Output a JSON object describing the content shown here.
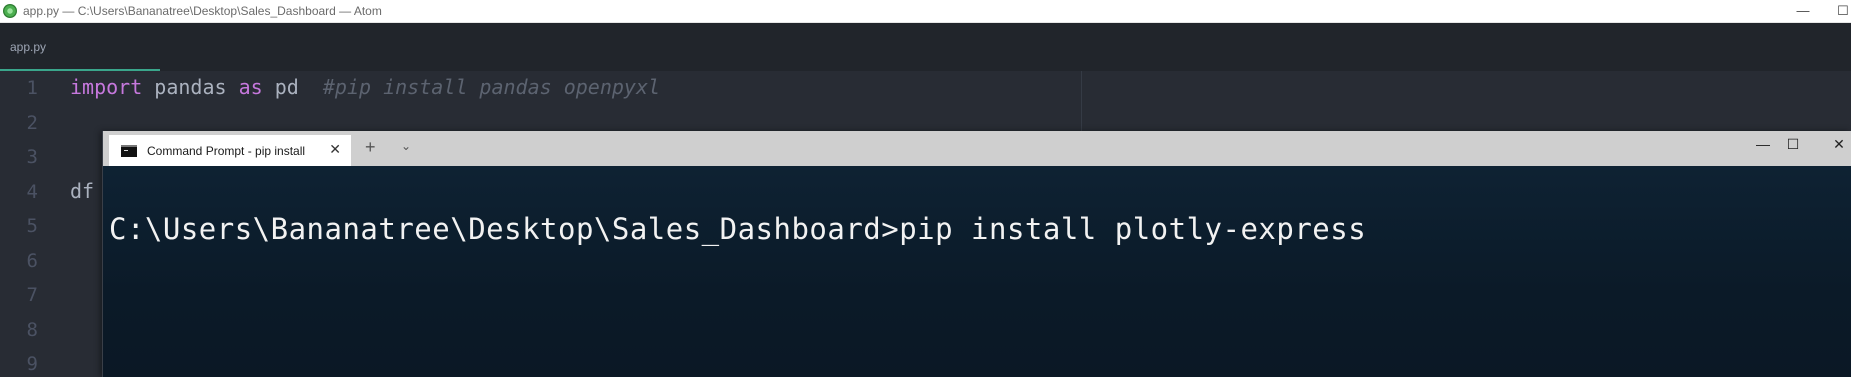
{
  "atom": {
    "window_title": "app.py — C:\\Users\\Bananatree\\Desktop\\Sales_Dashboard — Atom",
    "window_controls": {
      "minimize": "—",
      "maximize": "☐"
    },
    "tab": "app.py"
  },
  "editor": {
    "line_numbers": [
      "1",
      "2",
      "3",
      "4",
      "5",
      "6",
      "7",
      "8",
      "9"
    ],
    "line1": {
      "kw1": "import",
      "t1": " pandas ",
      "kw2": "as",
      "t2": " pd  ",
      "comment": "#pip install pandas openpyxl"
    },
    "line4": {
      "text": "df"
    }
  },
  "cmd": {
    "tab_label": "Command Prompt - pip  install",
    "tab_close": "✕",
    "new_tab": "+",
    "dropdown": "⌄",
    "controls": {
      "minimize": "—",
      "maximize": "☐",
      "close": "✕"
    },
    "command_line": "C:\\Users\\Bananatree\\Desktop\\Sales_Dashboard>pip install plotly-express"
  },
  "colors": {
    "editor_bg": "#282c34",
    "keyword": "#c678dd",
    "comment": "#5c6370",
    "tab_accent": "#3aa68b",
    "terminal_bg": "#0c1c2a"
  },
  "icons": [
    "atom-logo-icon",
    "cmd-terminal-icon",
    "close-icon",
    "plus-icon",
    "chevron-down-icon",
    "minimize-icon",
    "maximize-icon"
  ]
}
